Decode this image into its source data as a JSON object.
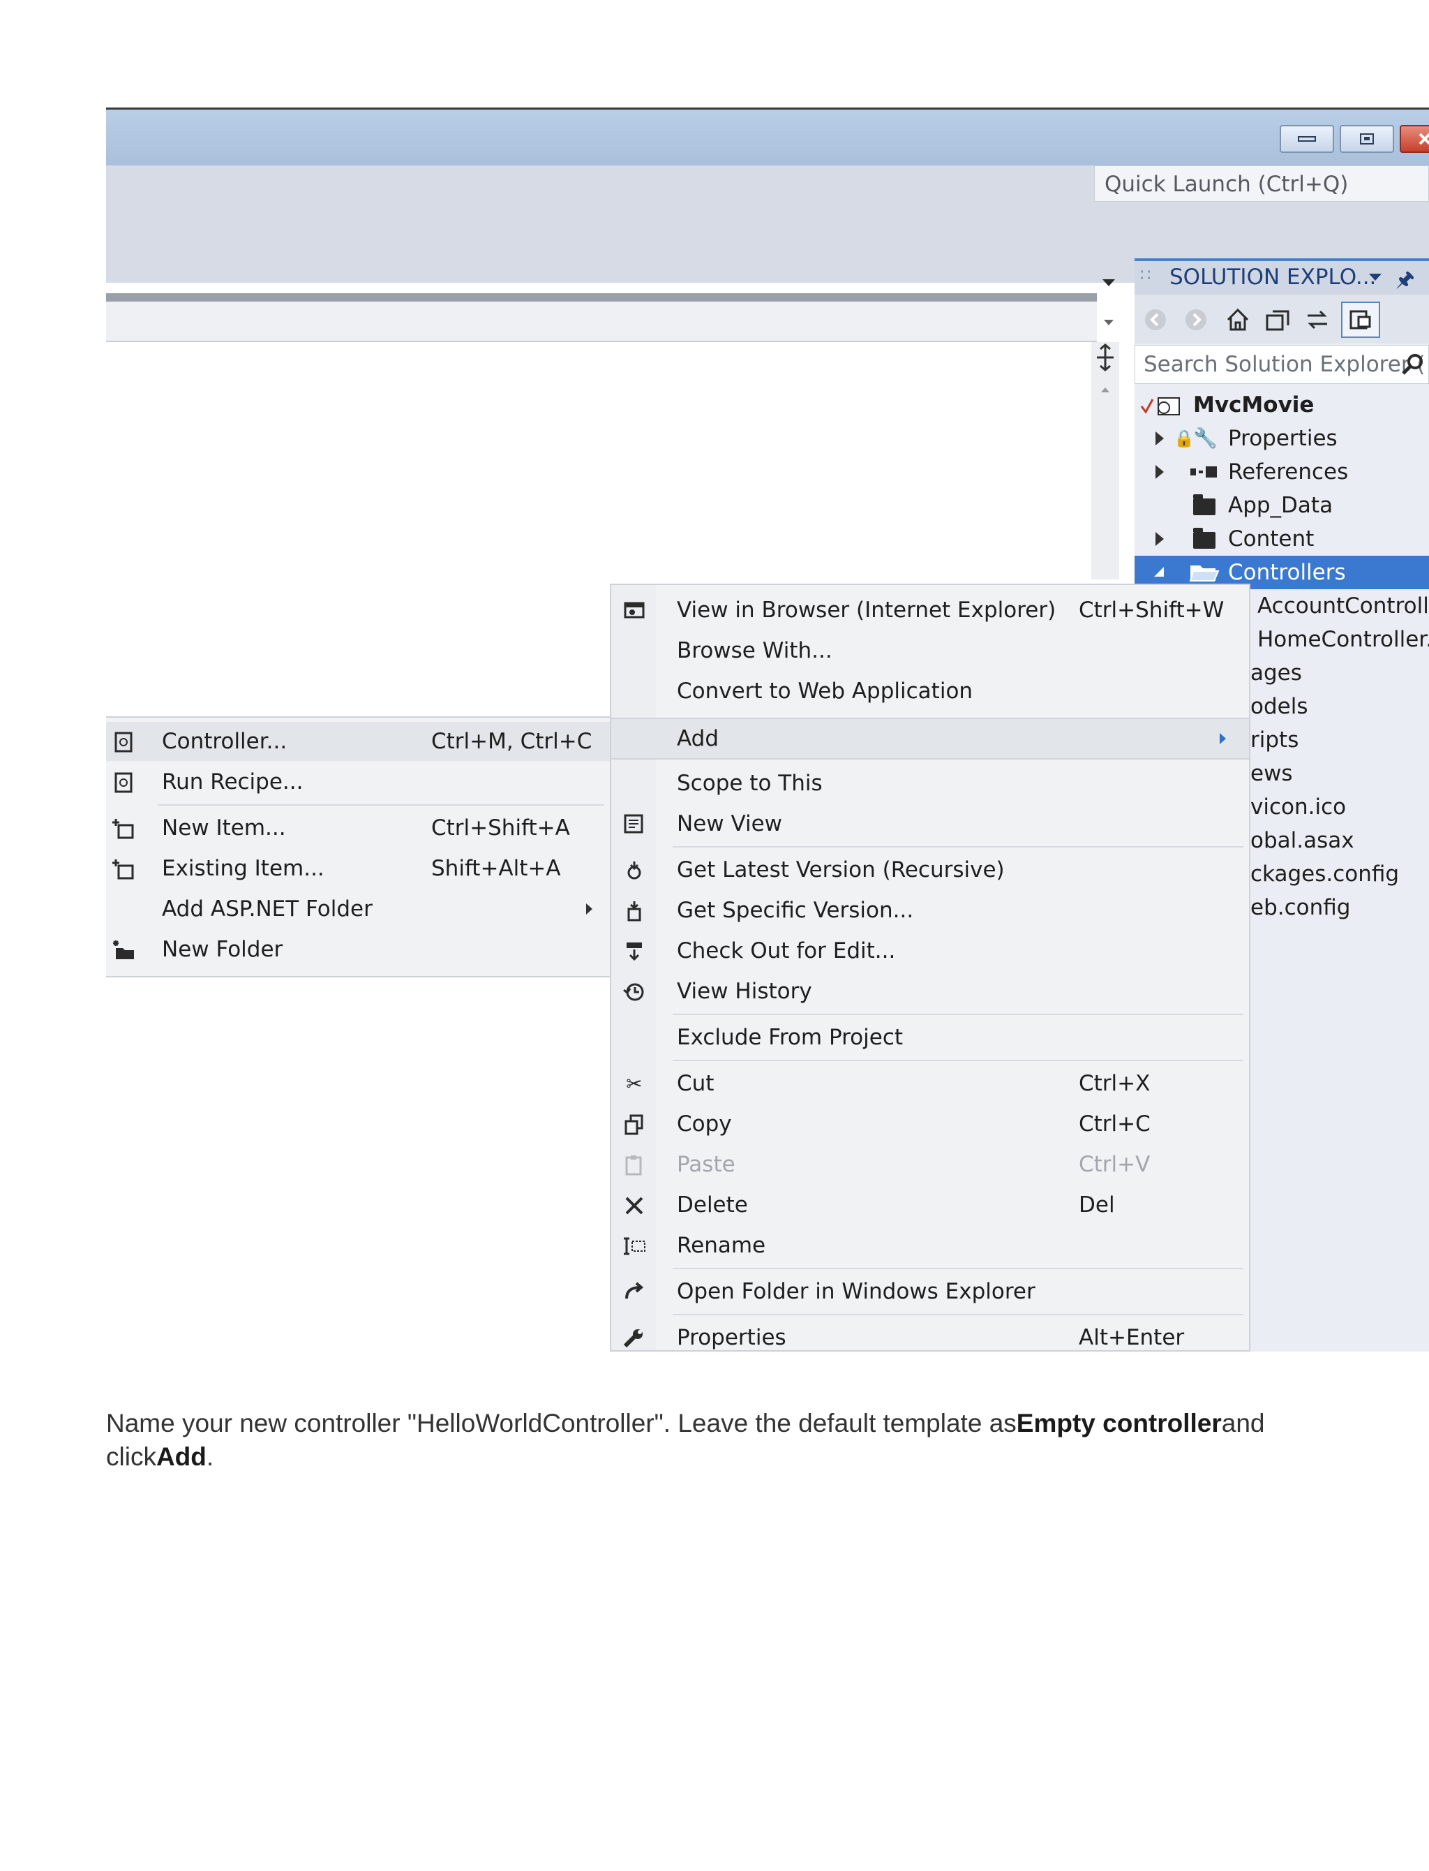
{
  "window": {
    "quick_launch_placeholder": "Quick Launch (Ctrl+Q)"
  },
  "solution_explorer": {
    "title": "SOLUTION EXPLO...",
    "search_placeholder": "Search Solution Explorer (",
    "tree": [
      {
        "label": "MvcMovie"
      },
      {
        "label": "Properties"
      },
      {
        "label": "References"
      },
      {
        "label": "App_Data"
      },
      {
        "label": "Content"
      },
      {
        "label": "Controllers"
      },
      {
        "label": "AccountControlle"
      },
      {
        "label": "HomeController.c"
      },
      {
        "label": "ages"
      },
      {
        "label": "odels"
      },
      {
        "label": "ripts"
      },
      {
        "label": "ews"
      },
      {
        "label": "vicon.ico"
      },
      {
        "label": "obal.asax"
      },
      {
        "label": "ckages.config"
      },
      {
        "label": "eb.config"
      }
    ],
    "selected_index": 5
  },
  "context_menu": {
    "items": [
      {
        "label": "View in Browser (Internet Explorer)",
        "shortcut": "Ctrl+Shift+W",
        "icon": "browser-icon"
      },
      {
        "label": "Browse With...",
        "shortcut": ""
      },
      {
        "label": "Convert to Web Application",
        "shortcut": ""
      },
      {
        "label": "Add",
        "shortcut": ""
      },
      {
        "label": "Scope to This",
        "shortcut": ""
      },
      {
        "label": "New View",
        "shortcut": "",
        "icon": "new-view-icon"
      },
      {
        "label": "Get Latest Version (Recursive)",
        "shortcut": "",
        "icon": "get-latest-icon"
      },
      {
        "label": "Get Specific Version...",
        "shortcut": "",
        "icon": "get-specific-icon"
      },
      {
        "label": "Check Out for Edit...",
        "shortcut": "",
        "icon": "checkout-icon"
      },
      {
        "label": "View History",
        "shortcut": "",
        "icon": "history-icon"
      },
      {
        "label": "Exclude From Project",
        "shortcut": ""
      },
      {
        "label": "Cut",
        "shortcut": "Ctrl+X",
        "icon": "cut-icon"
      },
      {
        "label": "Copy",
        "shortcut": "Ctrl+C",
        "icon": "copy-icon"
      },
      {
        "label": "Paste",
        "shortcut": "Ctrl+V",
        "icon": "paste-icon",
        "disabled": true
      },
      {
        "label": "Delete",
        "shortcut": "Del",
        "icon": "delete-icon"
      },
      {
        "label": "Rename",
        "shortcut": "",
        "icon": "rename-icon"
      },
      {
        "label": "Open Folder in Windows Explorer",
        "shortcut": "",
        "icon": "open-folder-icon"
      },
      {
        "label": "Properties",
        "shortcut": "Alt+Enter",
        "icon": "wrench-icon"
      }
    ]
  },
  "add_submenu": {
    "items": [
      {
        "label": "Controller...",
        "shortcut": "Ctrl+M, Ctrl+C",
        "icon": "controller-icon"
      },
      {
        "label": "Run Recipe...",
        "shortcut": "",
        "icon": "recipe-icon"
      },
      {
        "label": "New Item...",
        "shortcut": "Ctrl+Shift+A",
        "icon": "new-item-icon"
      },
      {
        "label": "Existing Item...",
        "shortcut": "Shift+Alt+A",
        "icon": "existing-item-icon"
      },
      {
        "label": "Add ASP.NET Folder",
        "shortcut": ""
      },
      {
        "label": "New Folder",
        "shortcut": "",
        "icon": "new-folder-icon"
      }
    ]
  },
  "caption": {
    "part1": "Name your new controller \"HelloWorldController\". Leave the default template as",
    "bold1": "Empty controller",
    "part2": "and click",
    "bold2": "Add",
    "part3": "."
  }
}
